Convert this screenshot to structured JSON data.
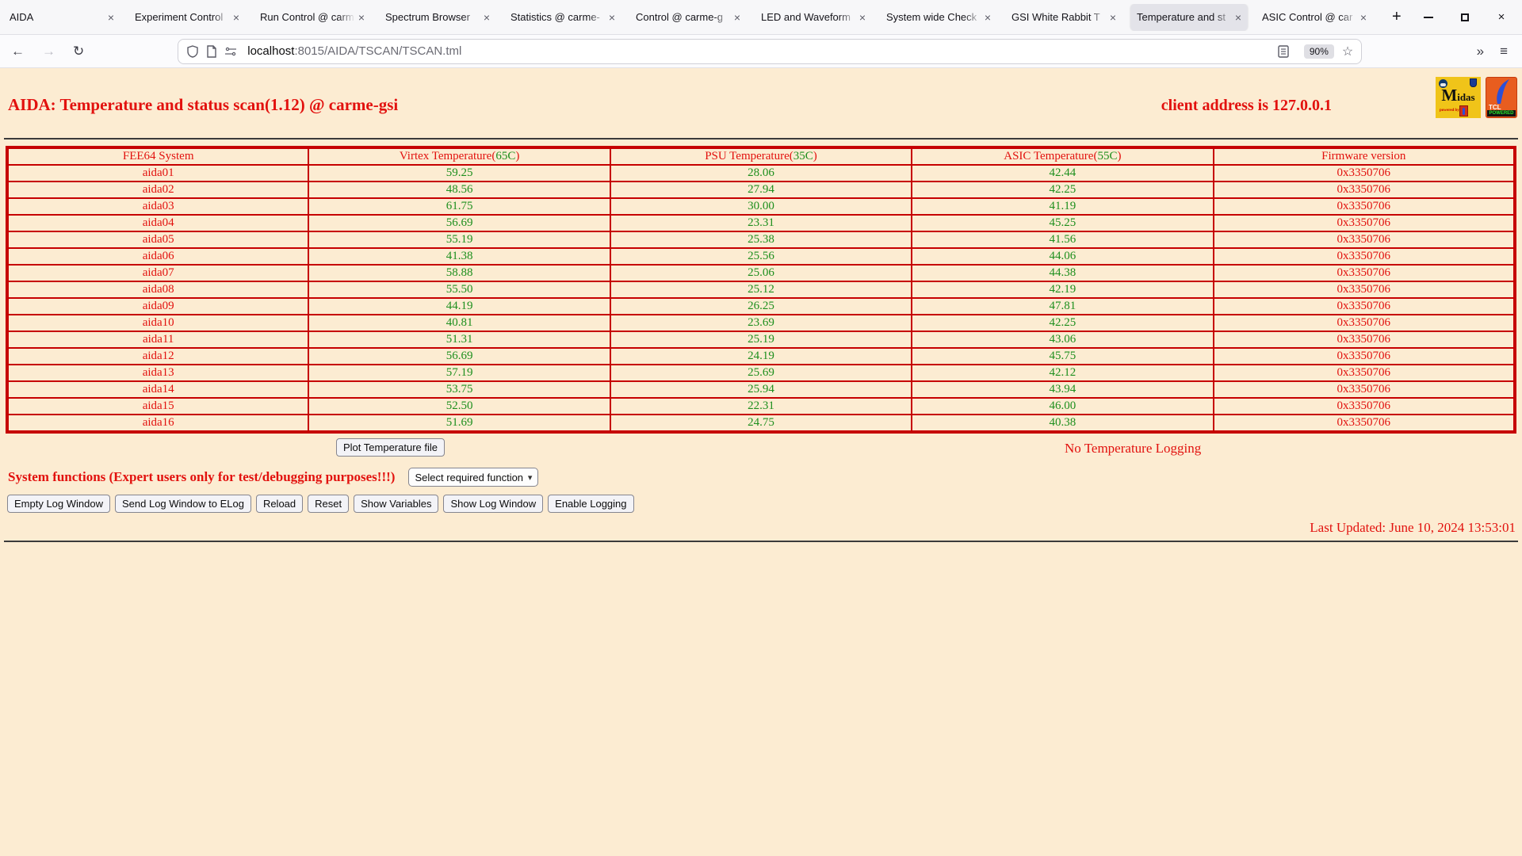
{
  "browser": {
    "tabs": [
      {
        "title": "AIDA",
        "active": false
      },
      {
        "title": "Experiment Control",
        "active": false
      },
      {
        "title": "Run Control @ carm",
        "active": false
      },
      {
        "title": "Spectrum Browser",
        "active": false
      },
      {
        "title": "Statistics @ carme-",
        "active": false
      },
      {
        "title": "Control @ carme-g",
        "active": false
      },
      {
        "title": "LED and Waveform",
        "active": false
      },
      {
        "title": "System wide Check",
        "active": false
      },
      {
        "title": "GSI White Rabbit T",
        "active": false
      },
      {
        "title": "Temperature and st",
        "active": true
      },
      {
        "title": "ASIC Control @ car",
        "active": false
      }
    ],
    "url": {
      "host": "localhost",
      "path": ":8015/AIDA/TSCAN/TSCAN.tml"
    },
    "zoom_level": "90%",
    "icons": {
      "close": "×",
      "new_tab": "+",
      "back": "←",
      "forward": "→",
      "reload": "↻",
      "star": "☆",
      "overflow": "»",
      "menu": "≡",
      "chevron": "▾"
    }
  },
  "page": {
    "title": "AIDA: Temperature and status scan(1.12) @ carme-gsi",
    "client_address": "client address is 127.0.0.1",
    "logos": {
      "midas_text": "Midas",
      "midas_sub": "powered by",
      "tcl_text": "TCL",
      "tcl_sub": "POWERED"
    },
    "table": {
      "headers": [
        {
          "label": "FEE64 System",
          "limit": "",
          "close": ""
        },
        {
          "label": "Virtex Temperature(",
          "limit": "65C",
          "close": ")"
        },
        {
          "label": "PSU Temperature(",
          "limit": "35C",
          "close": ")"
        },
        {
          "label": "ASIC Temperature(",
          "limit": "55C",
          "close": ")"
        },
        {
          "label": "Firmware version",
          "limit": "",
          "close": ""
        }
      ],
      "rows": [
        [
          "aida01",
          "59.25",
          "28.06",
          "42.44",
          "0x3350706"
        ],
        [
          "aida02",
          "48.56",
          "27.94",
          "42.25",
          "0x3350706"
        ],
        [
          "aida03",
          "61.75",
          "30.00",
          "41.19",
          "0x3350706"
        ],
        [
          "aida04",
          "56.69",
          "23.31",
          "45.25",
          "0x3350706"
        ],
        [
          "aida05",
          "55.19",
          "25.38",
          "41.56",
          "0x3350706"
        ],
        [
          "aida06",
          "41.38",
          "25.56",
          "44.06",
          "0x3350706"
        ],
        [
          "aida07",
          "58.88",
          "25.06",
          "44.38",
          "0x3350706"
        ],
        [
          "aida08",
          "55.50",
          "25.12",
          "42.19",
          "0x3350706"
        ],
        [
          "aida09",
          "44.19",
          "26.25",
          "47.81",
          "0x3350706"
        ],
        [
          "aida10",
          "40.81",
          "23.69",
          "42.25",
          "0x3350706"
        ],
        [
          "aida11",
          "51.31",
          "25.19",
          "43.06",
          "0x3350706"
        ],
        [
          "aida12",
          "56.69",
          "24.19",
          "45.75",
          "0x3350706"
        ],
        [
          "aida13",
          "57.19",
          "25.69",
          "42.12",
          "0x3350706"
        ],
        [
          "aida14",
          "53.75",
          "25.94",
          "43.94",
          "0x3350706"
        ],
        [
          "aida15",
          "52.50",
          "22.31",
          "46.00",
          "0x3350706"
        ],
        [
          "aida16",
          "51.69",
          "24.75",
          "40.38",
          "0x3350706"
        ]
      ]
    },
    "plot_button": "Plot Temperature file",
    "logging_status": "No Temperature Logging",
    "system_functions_label": "System functions (Expert users only for test/debugging purposes!!!)",
    "function_select": "Select required function",
    "action_buttons": [
      "Empty Log Window",
      "Send Log Window to ELog",
      "Reload",
      "Reset",
      "Show Variables",
      "Show Log Window",
      "Enable Logging"
    ],
    "last_updated": "Last Updated: June 10, 2024 13:53:01"
  }
}
